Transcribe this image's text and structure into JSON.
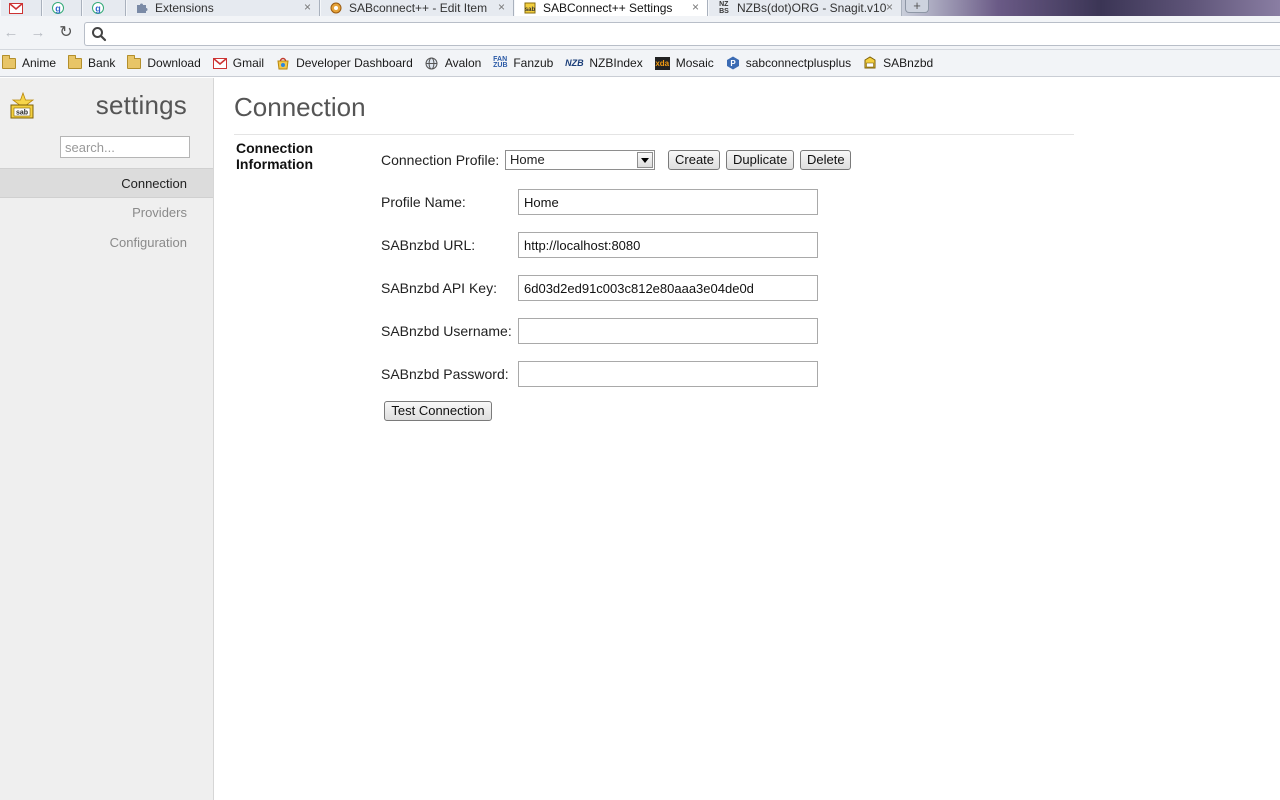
{
  "browser": {
    "tabs": [
      {
        "icon": "gmail-icon",
        "title": "",
        "active": false
      },
      {
        "icon": "google-icon",
        "title": "",
        "active": false
      },
      {
        "icon": "google-icon",
        "title": "",
        "active": false
      },
      {
        "icon": "puzzle-icon",
        "title": "Extensions",
        "active": false
      },
      {
        "icon": "sabconnect-icon",
        "title": "SABconnect++ - Edit Item",
        "active": false
      },
      {
        "icon": "sabnzbd-icon",
        "title": "SABConnect++ Settings",
        "active": true
      },
      {
        "icon": "nzbs-icon",
        "title": "NZBs(dot)ORG - Snagit.v10.",
        "active": false
      }
    ],
    "new_tab_label": "+",
    "close_glyph": "×",
    "address_value": ""
  },
  "bookmarks": [
    {
      "label": "Anime",
      "icon": "folder-icon"
    },
    {
      "label": "Bank",
      "icon": "folder-icon"
    },
    {
      "label": "Download",
      "icon": "folder-icon"
    },
    {
      "label": "Gmail",
      "icon": "gmail-icon"
    },
    {
      "label": "Developer Dashboard",
      "icon": "chrome-webstore-icon"
    },
    {
      "label": "Avalon",
      "icon": "globe-icon"
    },
    {
      "label": "Fanzub",
      "icon": "fanzub-icon"
    },
    {
      "label": "NZBIndex",
      "icon": "nzb-icon"
    },
    {
      "label": "Mosaic",
      "icon": "xda-icon"
    },
    {
      "label": "sabconnectplusplus",
      "icon": "project-icon"
    },
    {
      "label": "SABnzbd",
      "icon": "sabnzbd-icon"
    }
  ],
  "sidebar": {
    "title": "settings",
    "search_placeholder": "search...",
    "items": [
      {
        "label": "Connection",
        "active": true
      },
      {
        "label": "Providers",
        "active": false
      },
      {
        "label": "Configuration",
        "active": false
      }
    ]
  },
  "main": {
    "heading": "Connection",
    "section_title": "Connection Information",
    "connection_profile": {
      "label": "Connection Profile:",
      "selected": "Home",
      "buttons": {
        "create": "Create",
        "duplicate": "Duplicate",
        "delete": "Delete"
      }
    },
    "fields": [
      {
        "label": "Profile Name:",
        "value": ""
      },
      {
        "label": "SABnzbd URL:",
        "value": "http://localhost:8080"
      },
      {
        "label": "SABnzbd API Key:",
        "value": "6d03d2ed91c003c812e80aaa3e04de0d"
      },
      {
        "label": "SABnzbd Username:",
        "value": ""
      },
      {
        "label": "SABnzbd Password:",
        "value": ""
      }
    ],
    "profile_name_value": "Home",
    "test_button": "Test Connection"
  },
  "colors": {
    "sidebar_bg": "#efefef",
    "active_nav_bg": "#dcdcdc",
    "heading_text": "#555555"
  }
}
